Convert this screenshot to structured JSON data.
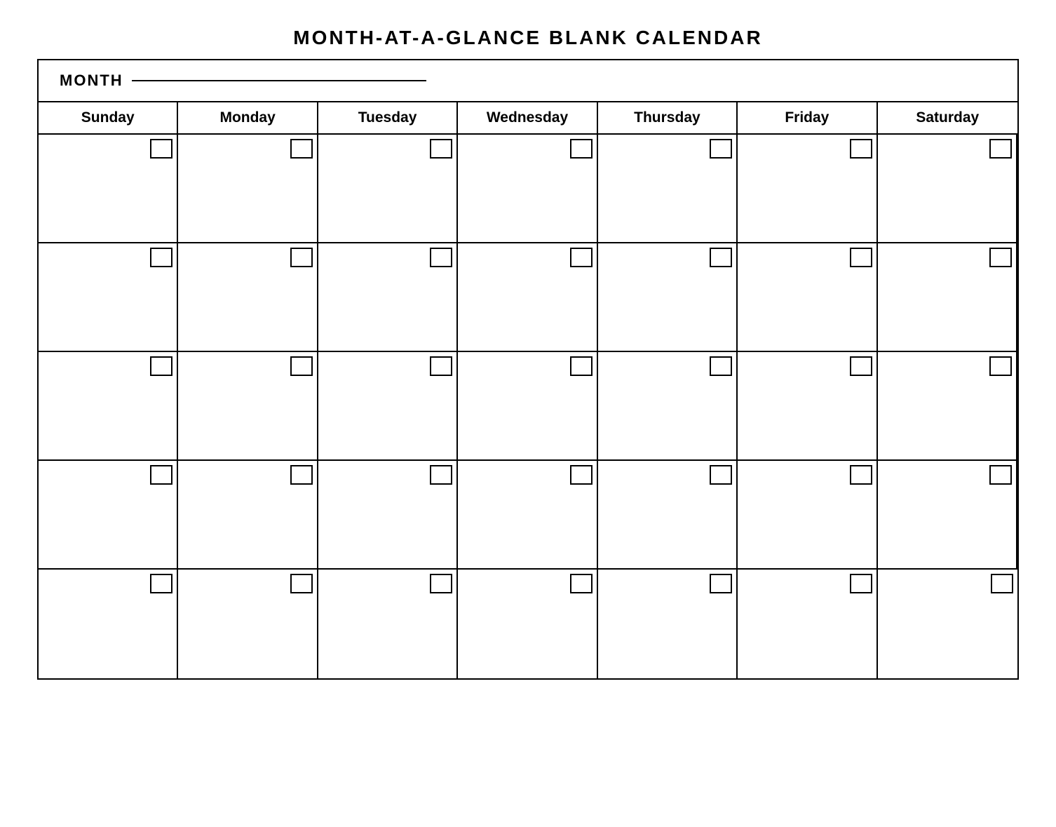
{
  "title": "MONTH-AT-A-GLANCE  BLANK  CALENDAR",
  "month_label": "MONTH",
  "days": [
    "Sunday",
    "Monday",
    "Tuesday",
    "Wednesday",
    "Thursday",
    "Friday",
    "Saturday"
  ],
  "weeks": 5
}
